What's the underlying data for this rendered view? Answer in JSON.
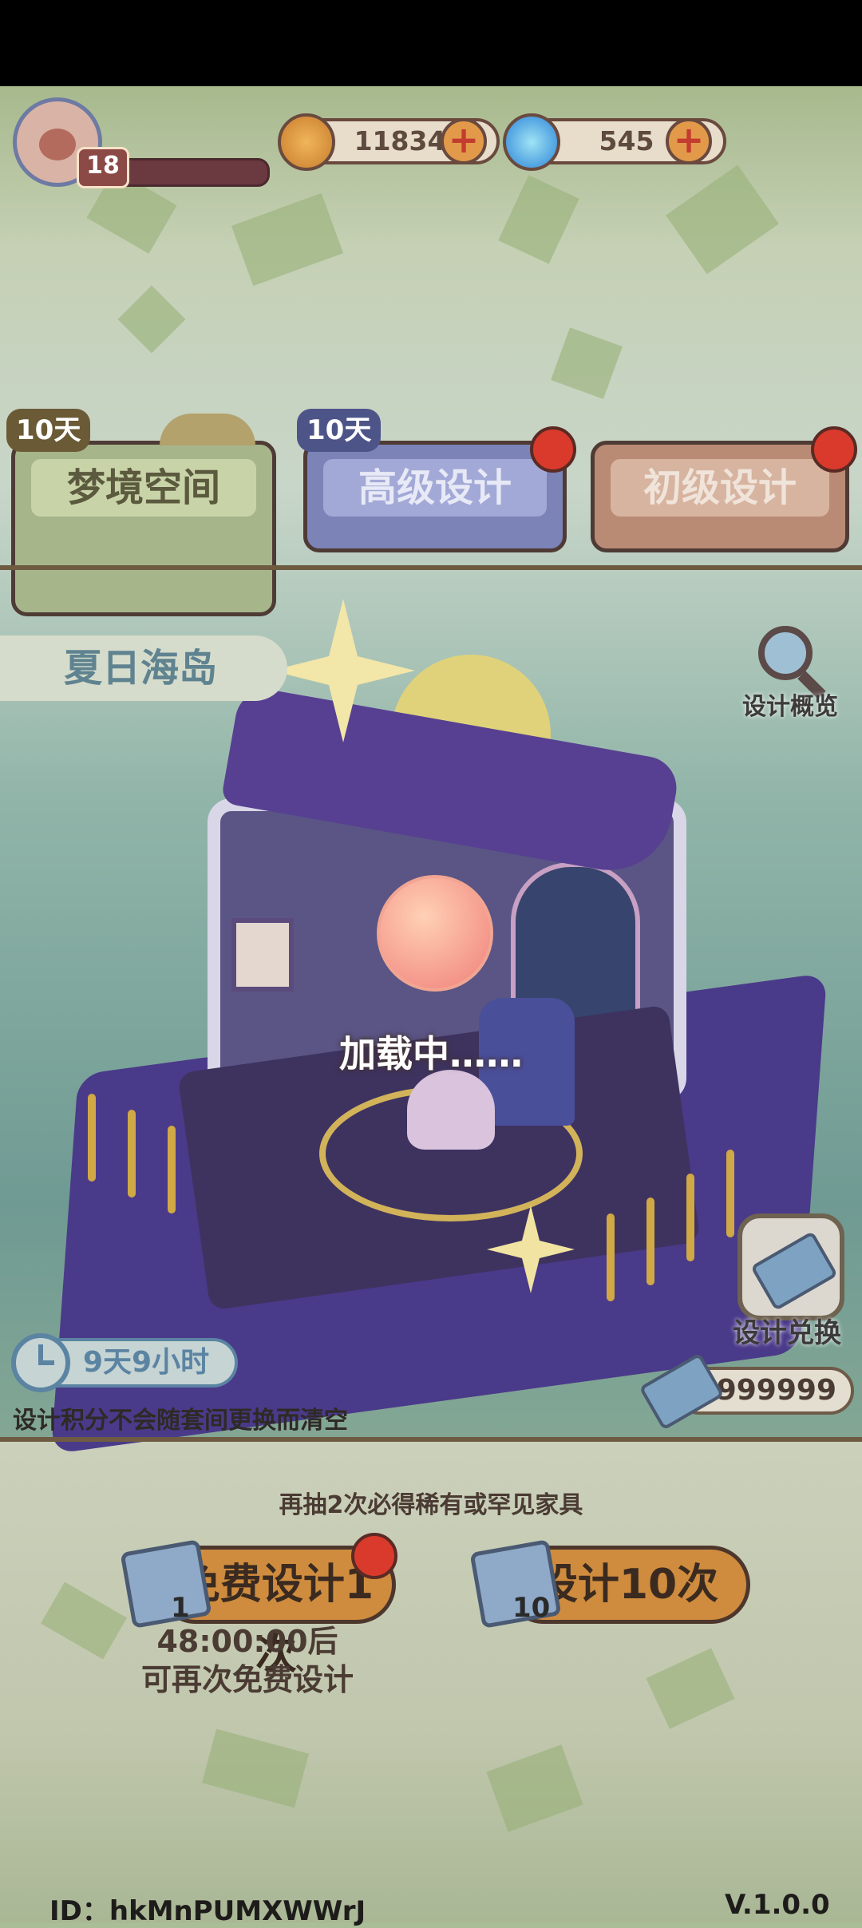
{
  "player": {
    "level": "18"
  },
  "currencies": [
    {
      "icon": "gold-coin-icon",
      "value": "11834"
    },
    {
      "icon": "blue-swirl-icon",
      "value": "545"
    }
  ],
  "tabs": [
    {
      "label": "梦境空间",
      "days": "10天",
      "selected": true,
      "badge": false
    },
    {
      "label": "高级设计",
      "days": "10天",
      "selected": false,
      "badge": true
    },
    {
      "label": "初级设计",
      "days": "",
      "selected": false,
      "badge": true
    }
  ],
  "scene": {
    "set_name": "夏日海岛",
    "overview_label": "设计概览",
    "loading_text": "加载中……",
    "exchange_label": "设计兑换",
    "timer": "9天9小时",
    "points_note": "设计积分不会随套间更换而清空",
    "points": "9999999"
  },
  "draw": {
    "guarantee_text": "再抽2次必得稀有或罕见家具",
    "single_label": "免费设计1次",
    "single_scroll_count": "1",
    "ten_label": "设计10次",
    "ten_scroll_count": "10",
    "cooldown_time": "48:00:00后",
    "cooldown_text": "可再次免费设计"
  },
  "footer": {
    "player_id": "ID：hkMnPUMXWWrJ",
    "version": "V.1.0.0"
  },
  "colors": {
    "tab_green": "#a6b58a",
    "tab_blue": "#7b83b7",
    "tab_brown": "#b98a74",
    "accent_orange": "#cf8c3e",
    "badge_red": "#d93a2c"
  }
}
